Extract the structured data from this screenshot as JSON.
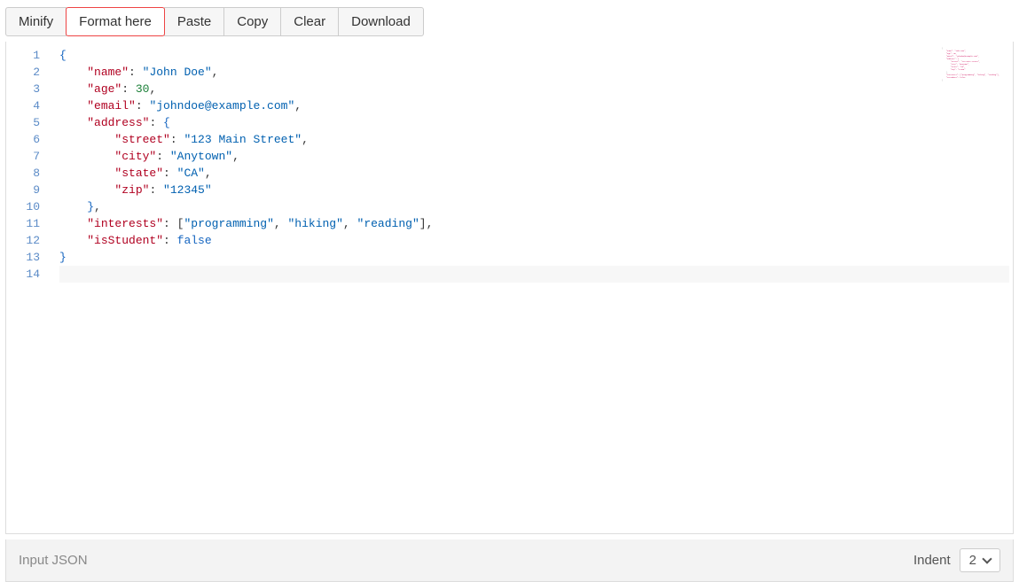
{
  "toolbar": {
    "minify": "Minify",
    "format": "Format here",
    "paste": "Paste",
    "copy": "Copy",
    "clear": "Clear",
    "download": "Download"
  },
  "editor": {
    "lines": [
      {
        "num": 1,
        "tokens": [
          {
            "t": "{",
            "c": "b"
          }
        ]
      },
      {
        "num": 2,
        "indent": 2,
        "tokens": [
          {
            "t": "\"name\"",
            "c": "k"
          },
          {
            "t": ": ",
            "c": "p"
          },
          {
            "t": "\"John Doe\"",
            "c": "s"
          },
          {
            "t": ",",
            "c": "p"
          }
        ]
      },
      {
        "num": 3,
        "indent": 2,
        "tokens": [
          {
            "t": "\"age\"",
            "c": "k"
          },
          {
            "t": ": ",
            "c": "p"
          },
          {
            "t": "30",
            "c": "n"
          },
          {
            "t": ",",
            "c": "p"
          }
        ]
      },
      {
        "num": 4,
        "indent": 2,
        "tokens": [
          {
            "t": "\"email\"",
            "c": "k"
          },
          {
            "t": ": ",
            "c": "p"
          },
          {
            "t": "\"johndoe@example.com\"",
            "c": "s"
          },
          {
            "t": ",",
            "c": "p"
          }
        ]
      },
      {
        "num": 5,
        "indent": 2,
        "tokens": [
          {
            "t": "\"address\"",
            "c": "k"
          },
          {
            "t": ": ",
            "c": "p"
          },
          {
            "t": "{",
            "c": "b"
          }
        ]
      },
      {
        "num": 6,
        "indent": 4,
        "tokens": [
          {
            "t": "\"street\"",
            "c": "k"
          },
          {
            "t": ": ",
            "c": "p"
          },
          {
            "t": "\"123 Main Street\"",
            "c": "s"
          },
          {
            "t": ",",
            "c": "p"
          }
        ]
      },
      {
        "num": 7,
        "indent": 4,
        "tokens": [
          {
            "t": "\"city\"",
            "c": "k"
          },
          {
            "t": ": ",
            "c": "p"
          },
          {
            "t": "\"Anytown\"",
            "c": "s"
          },
          {
            "t": ",",
            "c": "p"
          }
        ]
      },
      {
        "num": 8,
        "indent": 4,
        "tokens": [
          {
            "t": "\"state\"",
            "c": "k"
          },
          {
            "t": ": ",
            "c": "p"
          },
          {
            "t": "\"CA\"",
            "c": "s"
          },
          {
            "t": ",",
            "c": "p"
          }
        ]
      },
      {
        "num": 9,
        "indent": 4,
        "tokens": [
          {
            "t": "\"zip\"",
            "c": "k"
          },
          {
            "t": ": ",
            "c": "p"
          },
          {
            "t": "\"12345\"",
            "c": "s"
          }
        ]
      },
      {
        "num": 10,
        "indent": 2,
        "tokens": [
          {
            "t": "}",
            "c": "b"
          },
          {
            "t": ",",
            "c": "p"
          }
        ]
      },
      {
        "num": 11,
        "indent": 2,
        "tokens": [
          {
            "t": "\"interests\"",
            "c": "k"
          },
          {
            "t": ": ",
            "c": "p"
          },
          {
            "t": "[",
            "c": "p"
          },
          {
            "t": "\"programming\"",
            "c": "s"
          },
          {
            "t": ", ",
            "c": "p"
          },
          {
            "t": "\"hiking\"",
            "c": "s"
          },
          {
            "t": ", ",
            "c": "p"
          },
          {
            "t": "\"reading\"",
            "c": "s"
          },
          {
            "t": "]",
            "c": "p"
          },
          {
            "t": ",",
            "c": "p"
          }
        ]
      },
      {
        "num": 12,
        "indent": 2,
        "tokens": [
          {
            "t": "\"isStudent\"",
            "c": "k"
          },
          {
            "t": ": ",
            "c": "p"
          },
          {
            "t": "false",
            "c": "b"
          }
        ]
      },
      {
        "num": 13,
        "tokens": [
          {
            "t": "}",
            "c": "b"
          }
        ]
      },
      {
        "num": 14,
        "cursor": true,
        "tokens": []
      }
    ],
    "raw_json": {
      "name": "John Doe",
      "age": 30,
      "email": "johndoe@example.com",
      "address": {
        "street": "123 Main Street",
        "city": "Anytown",
        "state": "CA",
        "zip": "12345"
      },
      "interests": [
        "programming",
        "hiking",
        "reading"
      ],
      "isStudent": false
    }
  },
  "footer": {
    "label": "Input JSON",
    "indent_label": "Indent",
    "indent_value": "2"
  },
  "colors": {
    "highlight_border": "#e44",
    "key": "#b00020",
    "string": "#0060b0",
    "number": "#1a7f37",
    "brace": "#1565c0"
  }
}
